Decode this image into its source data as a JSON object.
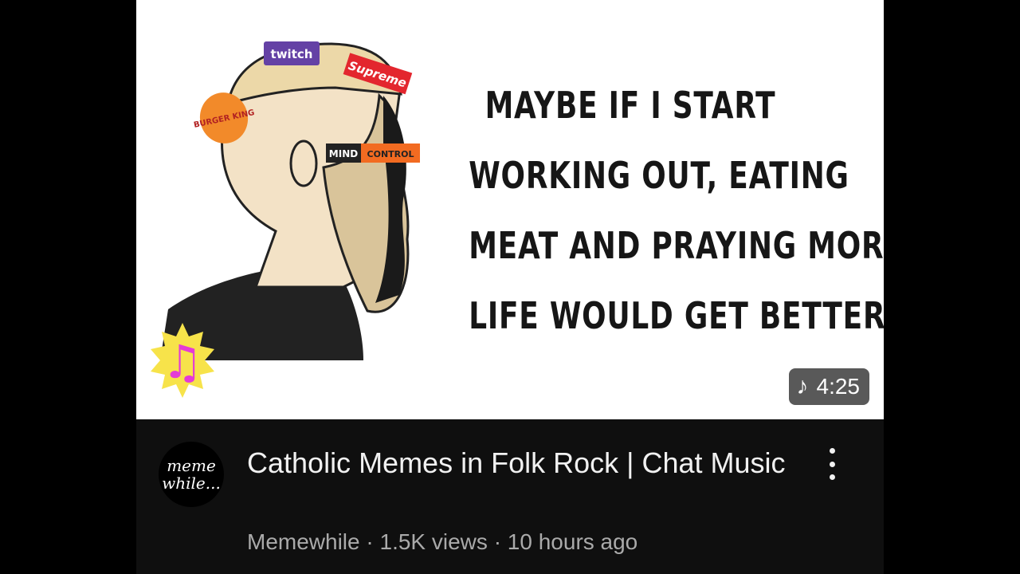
{
  "thumbnail": {
    "meme_lines": [
      "MAYBE IF I START",
      "WORKING OUT, EATING",
      "MEAT AND PRAYING MORE",
      "LIFE WOULD GET BETTER"
    ],
    "brand_labels": {
      "twitch": "twitch",
      "supreme": "Supreme",
      "burger_king": "BURGER KING",
      "mind": "MIND",
      "control": "CONTROL"
    },
    "duration": "4:25",
    "duration_icon": "music-note-icon",
    "badge_icon": "music-note-badge-icon"
  },
  "video": {
    "title": "Catholic Memes in Folk Rock | Chat Music",
    "channel": "Memewhile",
    "views": "1.5K views",
    "age": "10 hours ago",
    "separator": "·"
  },
  "avatar": {
    "line1": "meme",
    "line2": "while..."
  },
  "colors": {
    "background": "#000000",
    "card": "#0f0f0f",
    "title": "#f1f1f1",
    "subtext": "#aaaaaa",
    "badge_star": "#f7e34a",
    "badge_note": "#e43bd6",
    "twitch": "#6441a5",
    "supreme": "#e3262e",
    "burger_king": "#f28a2a"
  }
}
